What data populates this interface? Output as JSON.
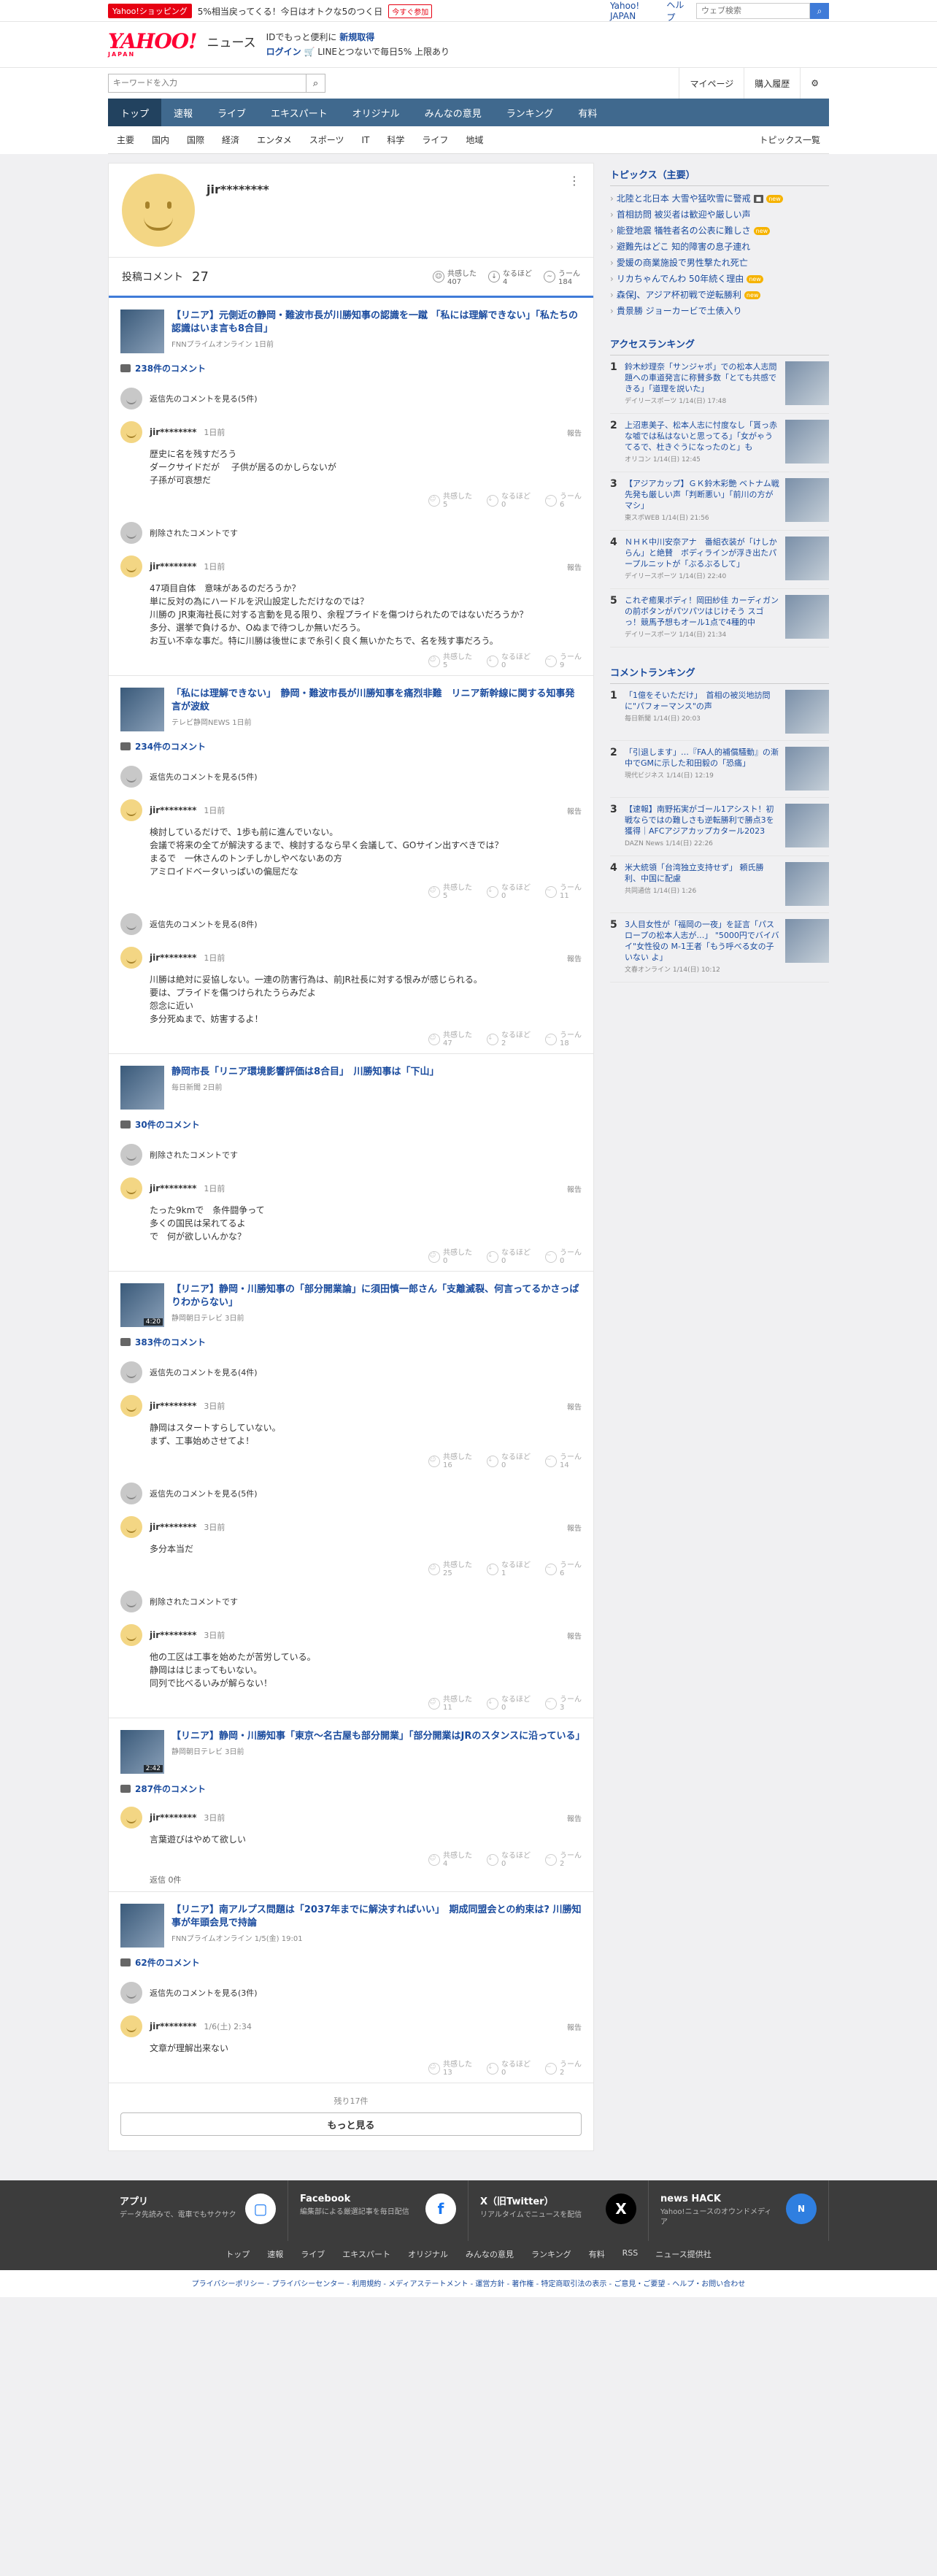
{
  "promo": {
    "tag": "Yahoo!ショッピング",
    "text": "5%相当戻ってくる！今日はオトクな5のつく日",
    "now": "今すぐ参加",
    "links": [
      "Yahoo! JAPAN",
      "ヘルプ"
    ],
    "search_placeholder": "ウェブ検索"
  },
  "header": {
    "logo": "YAHOO!",
    "logo_sub": "JAPAN",
    "service": "ニュース",
    "id_text": "IDでもっと便利に",
    "register": "新規取得",
    "login": "ログイン",
    "line_text": "LINEとつないで毎日5%",
    "limit": "上限あり"
  },
  "search": {
    "placeholder": "キーワードを入力",
    "links": [
      "マイページ",
      "購入履歴"
    ]
  },
  "nav": {
    "tabs": [
      "トップ",
      "速報",
      "ライブ",
      "エキスパート",
      "オリジナル",
      "みんなの意見",
      "ランキング",
      "有料"
    ],
    "sub": [
      "主要",
      "国内",
      "国際",
      "経済",
      "エンタメ",
      "スポーツ",
      "IT",
      "科学",
      "ライフ",
      "地域"
    ],
    "sub_right": "トピックス一覧"
  },
  "profile": {
    "name": "jir********",
    "post_label": "投稿コメント",
    "post_count": "27",
    "reactions": [
      {
        "label": "共感した",
        "value": "407"
      },
      {
        "label": "なるほど",
        "value": "4"
      },
      {
        "label": "うーん",
        "value": "184"
      }
    ]
  },
  "articles": [
    {
      "title": "【リニア】元側近の静岡・難波市長が川勝知事の認識を一蹴 「私には理解できない」「私たちの認識はいま言も8合目」",
      "source": "FNNプライムオンライン 1日前",
      "count": "238件のコメント",
      "items": [
        {
          "type": "collapsed",
          "text": "返信先のコメントを見る(5件)"
        },
        {
          "type": "comment",
          "user": "jir********",
          "time": "1日前",
          "body": "歴史に名を残すだろう\nダークサイドだが　 子供が居るのかしらないが\n子孫が可哀想だ",
          "r": [
            "5",
            "0",
            "6"
          ]
        },
        {
          "type": "collapsed",
          "text": "削除されたコメントです"
        },
        {
          "type": "comment",
          "user": "jir********",
          "time": "1日前",
          "body": "47項目自体　意味があるのだろうか？\n単に反対の為にハードルを沢山設定しただけなのでは？\n川勝の JR東海社長に対する言動を見る限り、余程プライドを傷つけられたのではないだろうか？\n多分、選挙で負けるか、Oぬまで待つしか無いだろう。\nお互い不幸な事だ。特に川勝は後世にまで糸引く良く無いかたちで、名を残す事だろう。",
          "r": [
            "5",
            "0",
            "9"
          ]
        }
      ]
    },
    {
      "title": "「私には理解できない」　静岡・難波市長が川勝知事を痛烈非難　リニア新幹線に関する知事発言が波紋",
      "source": "テレビ静岡NEWS 1日前",
      "count": "234件のコメント",
      "items": [
        {
          "type": "collapsed",
          "text": "返信先のコメントを見る(5件)"
        },
        {
          "type": "comment",
          "user": "jir********",
          "time": "1日前",
          "body": "検討しているだけで、1歩も前に進んでいない。\n会議で将来の全てが解決するまで、検討するなら早く会議して、GOサイン出すべきでは？\nまるで　一休さんのトンチしかしやべないあの方\nアミロイドベータいっぱいの偏屈だな",
          "r": [
            "5",
            "0",
            "11"
          ]
        },
        {
          "type": "collapsed",
          "text": "返信先のコメントを見る(8件)"
        },
        {
          "type": "comment",
          "user": "jir********",
          "time": "1日前",
          "body": "川勝は絶対に妥協しない。一連の防害行為は、前JR社長に対する恨みが感じられる。\n要は、プライドを傷つけられたうらみだよ\n怨念に近い\n多分死ぬまで、妨害するよ！",
          "r": [
            "47",
            "2",
            "18"
          ]
        }
      ]
    },
    {
      "title": "静岡市長「リニア環境影響評価は8合目」　川勝知事は「下山」",
      "source": "毎日新聞 2日前",
      "count": "30件のコメント",
      "items": [
        {
          "type": "collapsed",
          "text": "削除されたコメントです"
        },
        {
          "type": "comment",
          "user": "jir********",
          "time": "1日前",
          "body": "たった9kmで　条件闘争って\n多くの国民は呆れてるよ\nで　何が欲しいんかな？",
          "r": [
            "0",
            "0",
            "0"
          ]
        }
      ]
    },
    {
      "title": "【リニア】静岡・川勝知事の「部分開業論」に須田慎一郎さん「支離滅裂、何言ってるかさっぱりわからない」",
      "source": "静岡朝日テレビ 3日前",
      "count": "383件のコメント",
      "dur": "4:20",
      "items": [
        {
          "type": "collapsed",
          "text": "返信先のコメントを見る(4件)"
        },
        {
          "type": "comment",
          "user": "jir********",
          "time": "3日前",
          "body": "静岡はスタートすらしていない。\nまず、工事始めさせてよ！",
          "r": [
            "16",
            "0",
            "14"
          ]
        },
        {
          "type": "collapsed",
          "text": "返信先のコメントを見る(5件)"
        },
        {
          "type": "comment",
          "user": "jir********",
          "time": "3日前",
          "body": "多分本当だ",
          "r": [
            "25",
            "1",
            "6"
          ]
        },
        {
          "type": "collapsed",
          "text": "削除されたコメントです"
        },
        {
          "type": "comment",
          "user": "jir********",
          "time": "3日前",
          "body": "他の工区は工事を始めたが苦労している。\n静岡ははじまってもいない。\n同列で比べるいみが解らない！",
          "r": [
            "11",
            "0",
            "3"
          ]
        }
      ]
    },
    {
      "title": "【リニア】静岡・川勝知事「東京～名古屋も部分開業」「部分開業はJRのスタンスに沿っている」",
      "source": "静岡朝日テレビ 3日前",
      "count": "287件のコメント",
      "dur": "2:42",
      "items": [
        {
          "type": "comment",
          "user": "jir********",
          "time": "3日前",
          "body": "言葉遊びはやめて欲しい",
          "r": [
            "4",
            "0",
            "2"
          ],
          "reply": "返信 0件"
        }
      ]
    },
    {
      "title": "【リニア】南アルプス問題は「2037年までに解決すればいい」　期成同盟会との約束は? 川勝知事が年頭会見で持論",
      "source": "FNNプライムオンライン 1/5(金) 19:01",
      "count": "62件のコメント",
      "items": [
        {
          "type": "collapsed",
          "text": "返信先のコメントを見る(3件)"
        },
        {
          "type": "comment",
          "user": "jir********",
          "time": "1/6(土) 2:34",
          "body": "文章が理解出来ない",
          "r": [
            "13",
            "0",
            "2"
          ]
        }
      ]
    }
  ],
  "labels": {
    "report": "報告",
    "sympathy": "共感した",
    "naruhodo": "なるほど",
    "uun": "うーん"
  },
  "more": {
    "rest": "残り17件",
    "button": "もっと見る"
  },
  "topics": {
    "heading": "トピックス（主要）",
    "items": [
      {
        "t": "北陸と北日本 大雪や猛吹雪に警戒",
        "b": "new",
        "i": true
      },
      {
        "t": "首相訪問 被災者は歓迎や厳しい声"
      },
      {
        "t": "能登地震 犠牲者名の公表に難しさ",
        "b": "new"
      },
      {
        "t": "避難先はどこ 知的障害の息子連れ"
      },
      {
        "t": "愛媛の商業施設で男性撃たれ死亡"
      },
      {
        "t": "リカちゃんでんわ 50年続く理由",
        "b": "new"
      },
      {
        "t": "森保J、アジア杯初戦で逆転勝利",
        "b": "new"
      },
      {
        "t": "貴景勝 ジョーカービで土俵入り"
      }
    ]
  },
  "access": {
    "heading": "アクセスランキング",
    "items": [
      {
        "t": "鈴木紗理奈「サンジャポ」での松本人志問題への車道発言に称賛多数「とても共感できる」「道理を説いた」",
        "s": "デイリースポーツ 1/14(日) 17:48"
      },
      {
        "t": "上沼恵美子、松本人志に忖度なし「貰っ赤な嘘では私はないと思ってる」「女がゃうてるで、杜きぐうになったのと」も",
        "s": "オリコン 1/14(日) 12:45"
      },
      {
        "t": "【アジアカップ】ＧＫ鈴木彩艶 ベトナム戦先発も厳しい声「判断悪い」「前川の方がマシ」",
        "s": "東スポWEB 1/14(日) 21:56"
      },
      {
        "t": "ＮＨＫ中川安奈アナ　番組衣装が「けしからん」と絶賛　ボディラインが浮き出たパープルニットが「ぶるぶるして」",
        "s": "デイリースポーツ 1/14(日) 22:40"
      },
      {
        "t": "これぞ癒果ボディ！岡田紗佳 カーディガンの前ボタンがパツパツはじけそう スゴっ！競馬予想もオール1点で4種的中",
        "s": "デイリースポーツ 1/14(日) 21:34"
      }
    ]
  },
  "comment_rank": {
    "heading": "コメントランキング",
    "items": [
      {
        "t": "「1億をそいただけ」　首相の被災地訪問に\"パフォーマンス\"の声",
        "s": "毎日新聞 1/14(日) 20:03"
      },
      {
        "t": "「引退します」…『FA人的補償騒動』の漸中でGMに示した和田毅の「恐痛」",
        "s": "現代ビジネス 1/14(日) 12:19"
      },
      {
        "t": "【速報】南野拓実がゴール1アシスト！初戦ならではの難しさも逆転勝利で勝点3を獲得｜AFCアジアカップカタール2023",
        "s": "DAZN News 1/14(日) 22:26"
      },
      {
        "t": "米大統領「台湾独立支持せず」 頼氏勝利、中国に配慮",
        "s": "共同通信 1/14(日) 1:26"
      },
      {
        "t": "3人目女性が「福岡の一夜」を証言「パスロープの松本人志が…」 \"5000円でバイバイ\"女性役の M-1王者「もう呼べる女の子いない よ」",
        "s": "文春オンライン 1/14(日) 10:12"
      }
    ]
  },
  "footer": {
    "apps": [
      {
        "title": "アプリ",
        "desc": "データ先読みで、電車でもサクサク"
      },
      {
        "title": "Facebook",
        "desc": "編集部による厳選記事を毎日配信"
      },
      {
        "title": "X（旧Twitter）",
        "desc": "リアルタイムでニュースを配信"
      },
      {
        "title": "news HACK",
        "desc": "Yahoo!ニュースのオウンドメディア"
      }
    ],
    "links": [
      "トップ",
      "速報",
      "ライブ",
      "エキスパート",
      "オリジナル",
      "みんなの意見",
      "ランキング",
      "有料",
      "RSS",
      "ニュース提供社"
    ],
    "legal": "プライバシーポリシー - プライバシーセンター - 利用規約 - メディアステートメント - 運営方針 - 著作権 - 特定商取引法の表示 - ご意見・ご要望 - ヘルプ・お問い合わせ"
  }
}
